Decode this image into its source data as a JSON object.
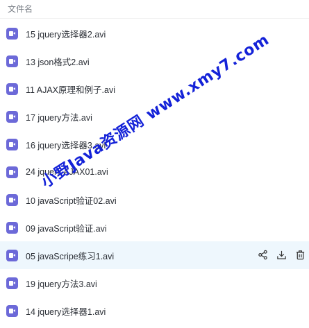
{
  "header": {
    "column_title": "文件名"
  },
  "files": [
    {
      "name": "15 jquery选择器2.avi",
      "icon": "video-file-icon"
    },
    {
      "name": "13 json格式2.avi",
      "icon": "video-file-icon"
    },
    {
      "name": "11 AJAX原理和例子.avi",
      "icon": "video-file-icon"
    },
    {
      "name": "17 jquery方法.avi",
      "icon": "video-file-icon"
    },
    {
      "name": "16 jquery选择器3.avi",
      "icon": "video-file-icon"
    },
    {
      "name": "24 jquery AJAX01.avi",
      "icon": "video-file-icon"
    },
    {
      "name": "10 javaScript验证02.avi",
      "icon": "video-file-icon"
    },
    {
      "name": "09 javaScript验证.avi",
      "icon": "video-file-icon"
    },
    {
      "name": "05 javaScripe练习1.avi",
      "icon": "video-file-icon",
      "hovered": true
    },
    {
      "name": "19 jquery方法3.avi",
      "icon": "video-file-icon"
    },
    {
      "name": "14 jquery选择器1.avi",
      "icon": "video-file-icon"
    }
  ],
  "row_actions": [
    "share-icon",
    "download-icon",
    "delete-icon"
  ],
  "watermark": {
    "text": "小野Java资源网  www.xmy7.com",
    "color": "#1422d8"
  },
  "colors": {
    "file_icon": "#6c69d8",
    "hover_row": "#eef7fd",
    "text": "#2b2f36"
  }
}
